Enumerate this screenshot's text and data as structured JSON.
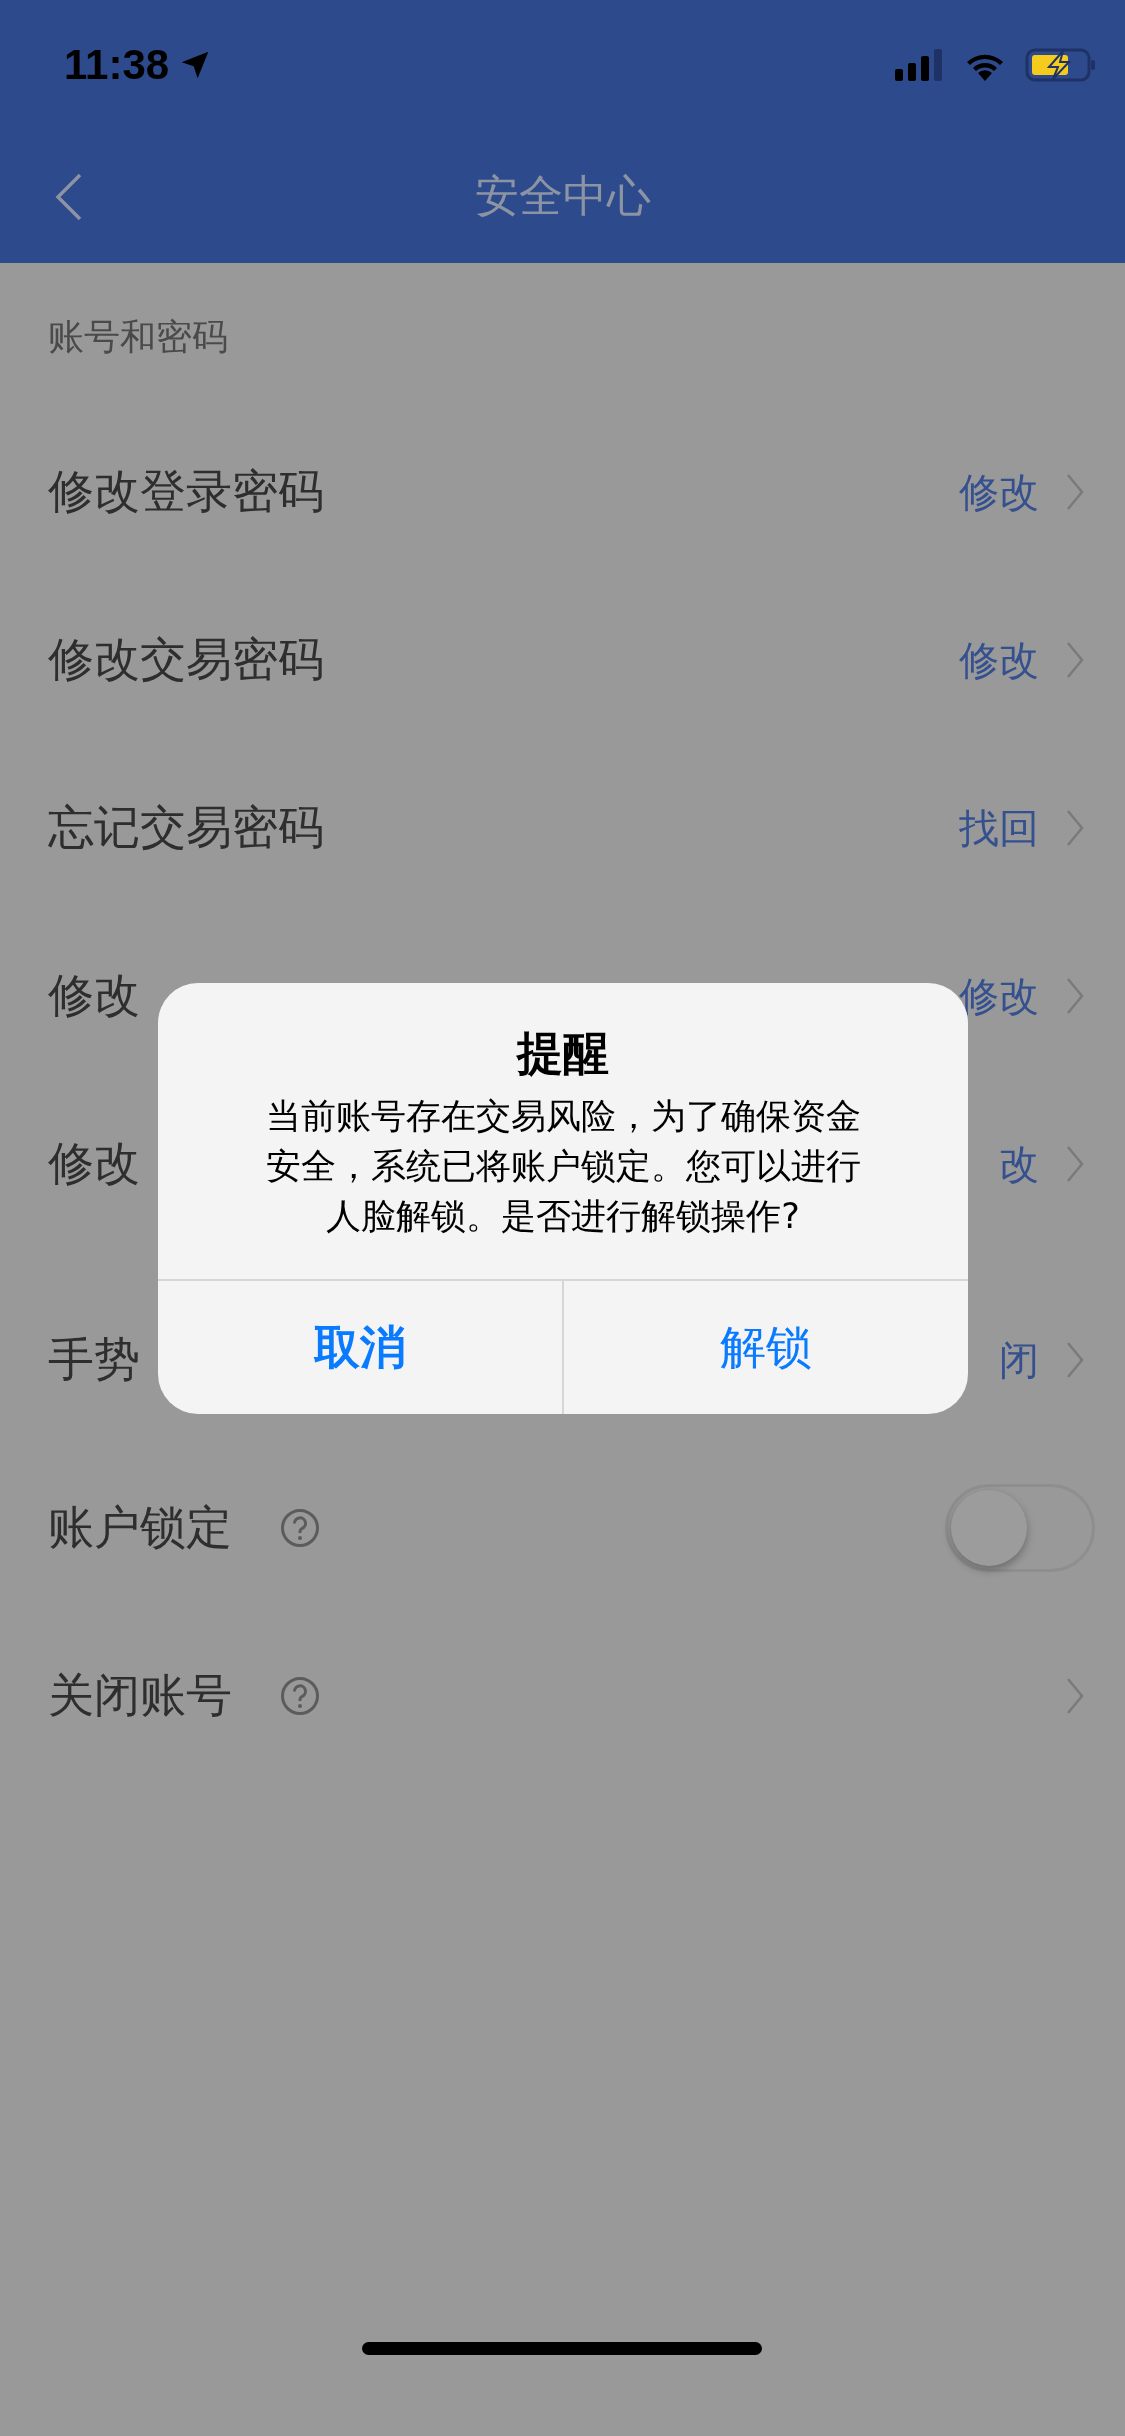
{
  "status_bar": {
    "time": "11:38"
  },
  "nav": {
    "title": "安全中心"
  },
  "section": {
    "title": "账号和密码"
  },
  "groups": [
    {
      "rows": [
        {
          "kind": "link",
          "label": "修改登录密码",
          "value": "修改"
        },
        {
          "kind": "link",
          "label": "修改交易密码",
          "value": "修改"
        },
        {
          "kind": "link",
          "label": "忘记交易密码",
          "value": "找回"
        },
        {
          "kind": "link",
          "label": "修改",
          "value": "修改"
        },
        {
          "kind": "link",
          "label": "修改",
          "value": "改"
        }
      ]
    },
    {
      "rows": [
        {
          "kind": "link",
          "label": "手势",
          "value": "闭"
        },
        {
          "kind": "toggle",
          "label": "账户锁定",
          "on": false,
          "help": true
        },
        {
          "kind": "link",
          "label": "关闭账号",
          "help": true
        }
      ]
    }
  ],
  "dialog": {
    "title": "提醒",
    "message": "当前账号存在交易风险，为了确保资金安全，系统已将账户锁定。您可以进行人脸解锁。是否进行解锁操作?",
    "buttons": [
      {
        "label": "取消",
        "bold": true
      },
      {
        "label": "解锁",
        "bold": false
      }
    ]
  }
}
